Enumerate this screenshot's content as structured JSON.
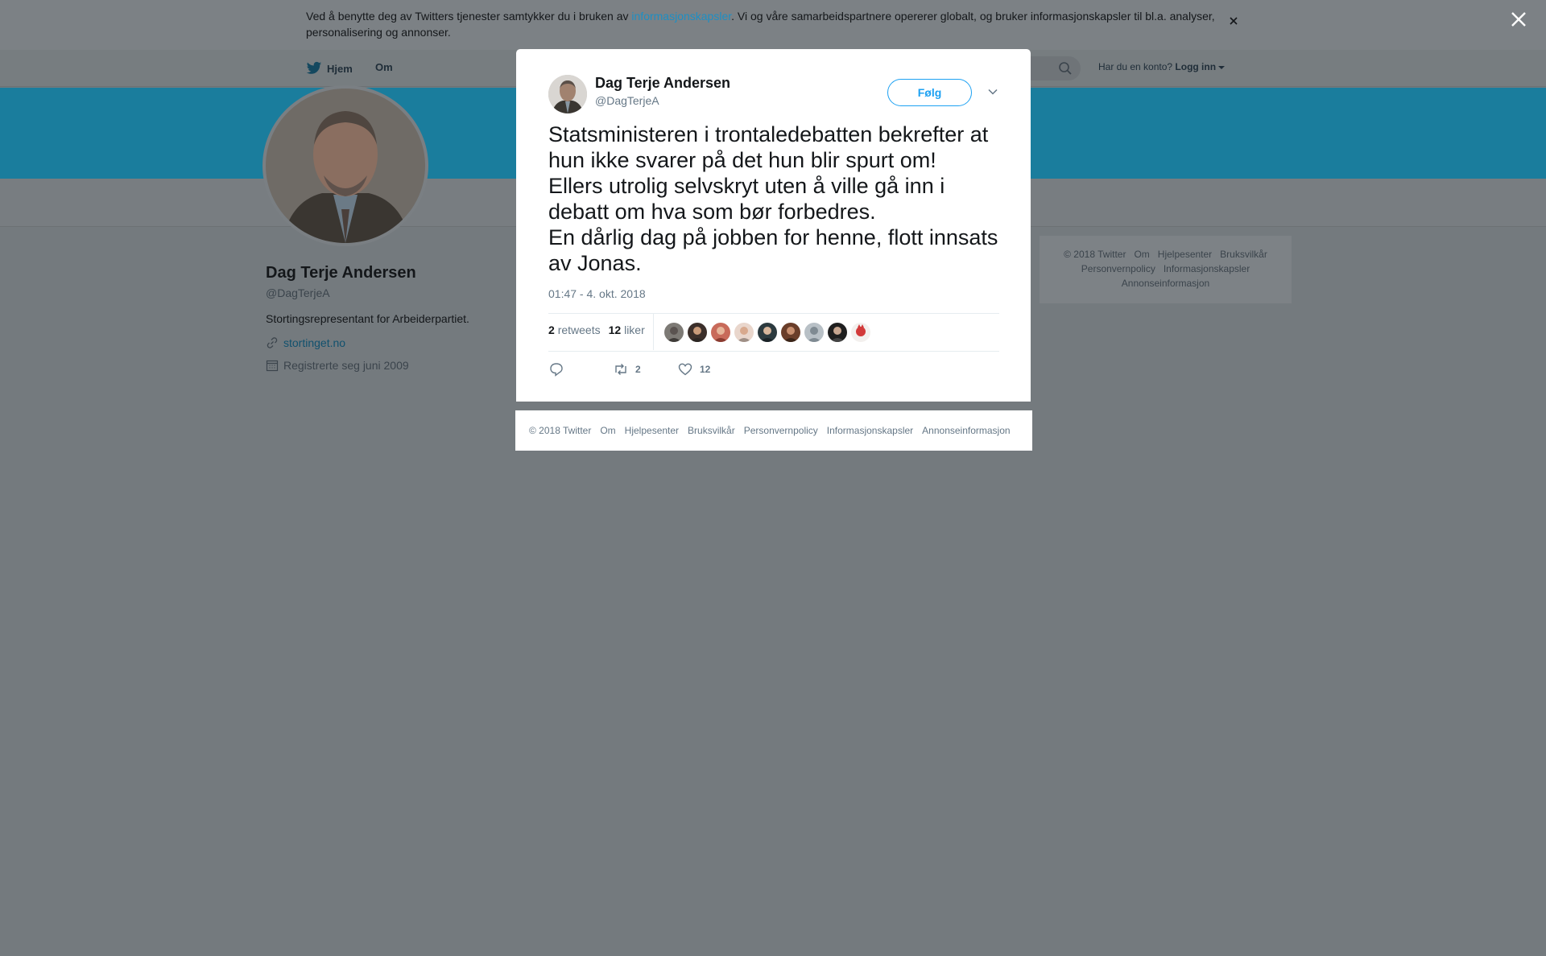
{
  "cookie_bar": {
    "text_before": "Ved å benytte deg av Twitters tjenester samtykker du i bruken av ",
    "link": "informasjonskapsler",
    "text_after": ". Vi og våre samarbeidspartnere opererer globalt, og bruker informasjonskapsler til bl.a. analyser, personalisering og annonser.",
    "close_icon": "close-icon"
  },
  "topnav": {
    "home": "Hjem",
    "about": "Om",
    "account_prompt": "Har du en konto?",
    "login": "Logg inn"
  },
  "profile": {
    "name": "Dag Terje Andersen",
    "handle": "@DagTerjeA",
    "bio": "Stortingsrepresentant for Arbeiderpartiet.",
    "website": "stortinget.no",
    "joined": "Registrerte seg juni 2009"
  },
  "side_footer": {
    "items": [
      "© 2018 Twitter",
      "Om",
      "Hjelpesenter",
      "Bruksvilkår",
      "Personvernpolicy",
      "Informasjonskapsler",
      "Annonseinformasjon"
    ]
  },
  "tweet": {
    "author_name": "Dag Terje Andersen",
    "author_handle": "@DagTerjeA",
    "follow_label": "Følg",
    "text": "Statsministeren i trontaledebatten bekrefter at hun ikke svarer på det hun blir spurt om!\nEllers utrolig selvskryt uten å ville gå inn i debatt om hva som bør forbedres.\nEn dårlig dag på jobben for henne, flott innsats av Jonas.",
    "timestamp": "01:47 - 4. okt. 2018",
    "retweets_count": "2",
    "retweets_label": "retweets",
    "likes_count": "12",
    "likes_label": "liker",
    "action_retweet_count": "2",
    "action_like_count": "12",
    "liker_count": 9
  },
  "modal_footer": {
    "items": [
      "© 2018 Twitter",
      "Om",
      "Hjelpesenter",
      "Bruksvilkår",
      "Personvernpolicy",
      "Informasjonskapsler",
      "Annonseinformasjon"
    ]
  },
  "colors": {
    "twitter_blue": "#1da1f2",
    "banner": "#1a7d9d",
    "overlay": "#747a7e"
  }
}
